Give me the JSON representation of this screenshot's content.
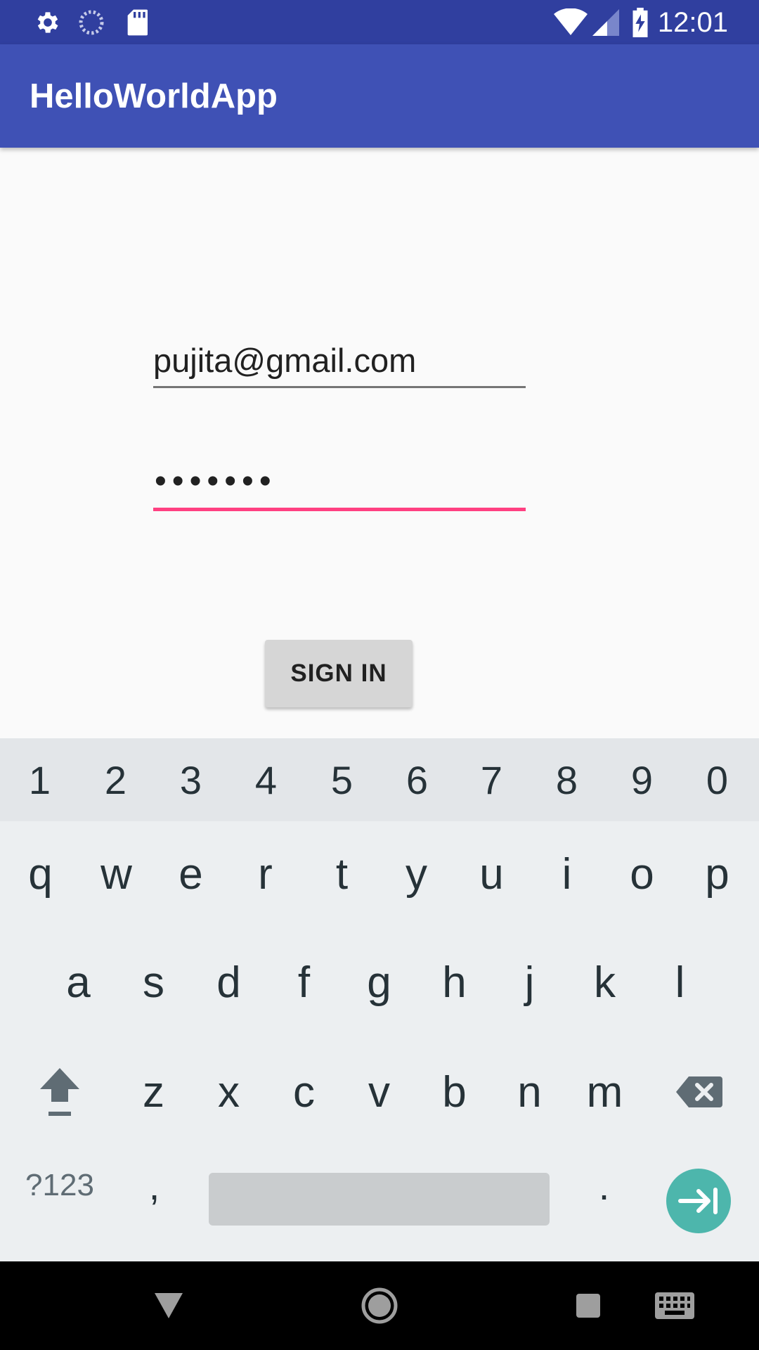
{
  "status_bar": {
    "time": "12:01",
    "icons": [
      "settings-icon",
      "sync-icon",
      "sd-card-icon",
      "wifi-icon",
      "signal-icon",
      "battery-charging-icon"
    ]
  },
  "app_bar": {
    "title": "HelloWorldApp"
  },
  "form": {
    "email_value": "pujita@gmail.com",
    "password_mask": "•••••••",
    "sign_in_label": "SIGN IN"
  },
  "keyboard": {
    "number_row": [
      "1",
      "2",
      "3",
      "4",
      "5",
      "6",
      "7",
      "8",
      "9",
      "0"
    ],
    "row_q": [
      "q",
      "w",
      "e",
      "r",
      "t",
      "y",
      "u",
      "i",
      "o",
      "p"
    ],
    "row_a": [
      "a",
      "s",
      "d",
      "f",
      "g",
      "h",
      "j",
      "k",
      "l"
    ],
    "row_z": [
      "z",
      "x",
      "c",
      "v",
      "b",
      "n",
      "m"
    ],
    "symbols_label": "?123",
    "comma": ",",
    "period": ".",
    "colors": {
      "enter": "#4db6ac",
      "accent": "#ff4081",
      "primary": "#3f51b5",
      "primary_dark": "#303f9f"
    }
  },
  "nav_bar": {
    "buttons": [
      "back-icon",
      "home-icon",
      "recents-icon",
      "keyboard-switch-icon"
    ]
  }
}
